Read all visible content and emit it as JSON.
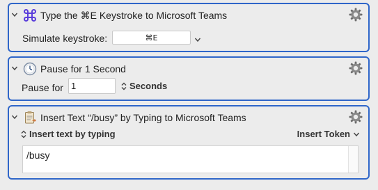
{
  "actions": [
    {
      "title": "Type the ⌘E Keystroke to Microsoft Teams",
      "field_label": "Simulate keystroke:",
      "keystroke": "⌘E"
    },
    {
      "title": "Pause for 1 Second",
      "field_label": "Pause for",
      "value": "1",
      "unit": "Seconds"
    },
    {
      "title": "Insert Text “/busy” by Typing to Microsoft Teams",
      "mode": "Insert text by typing",
      "token_menu": "Insert Token",
      "text": "/busy"
    }
  ],
  "colors": {
    "accent": "#2f66c9",
    "background": "#ececec"
  },
  "icons": [
    "chevron-down-icon",
    "command-key-icon",
    "clock-icon",
    "clipboard-text-icon",
    "gear-icon",
    "up-down-arrows-icon"
  ]
}
